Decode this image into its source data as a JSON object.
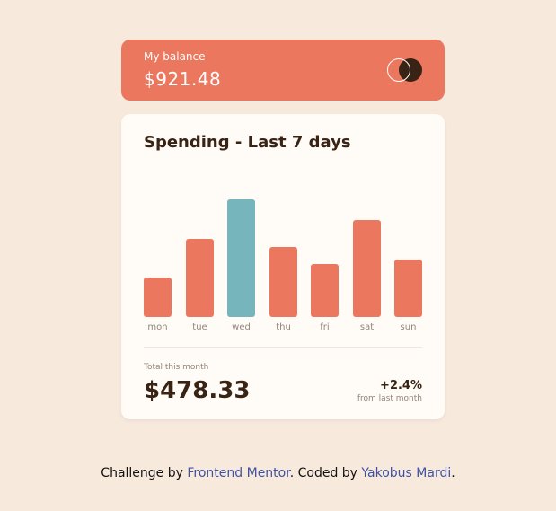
{
  "balance": {
    "label": "My balance",
    "amount": "$921.48"
  },
  "spending": {
    "title": "Spending - Last 7 days",
    "total_label": "Total this month",
    "total_amount": "$478.33",
    "change_value": "+2.4%",
    "change_label": "from last month"
  },
  "chart_data": {
    "type": "bar",
    "categories": [
      "mon",
      "tue",
      "wed",
      "thu",
      "fri",
      "sat",
      "sun"
    ],
    "values": [
      17.45,
      34.91,
      52.36,
      31.07,
      23.39,
      43.28,
      25.48
    ],
    "highlight_index": 2,
    "colors": {
      "bar": "#ec775f",
      "highlight": "#76b5bc"
    },
    "ylim": [
      0,
      52.36
    ]
  },
  "footer": {
    "prefix": "Challenge by ",
    "link1": "Frontend Mentor",
    "middle": ". Coded by ",
    "link2": "Yakobus Mardi",
    "suffix": "."
  }
}
